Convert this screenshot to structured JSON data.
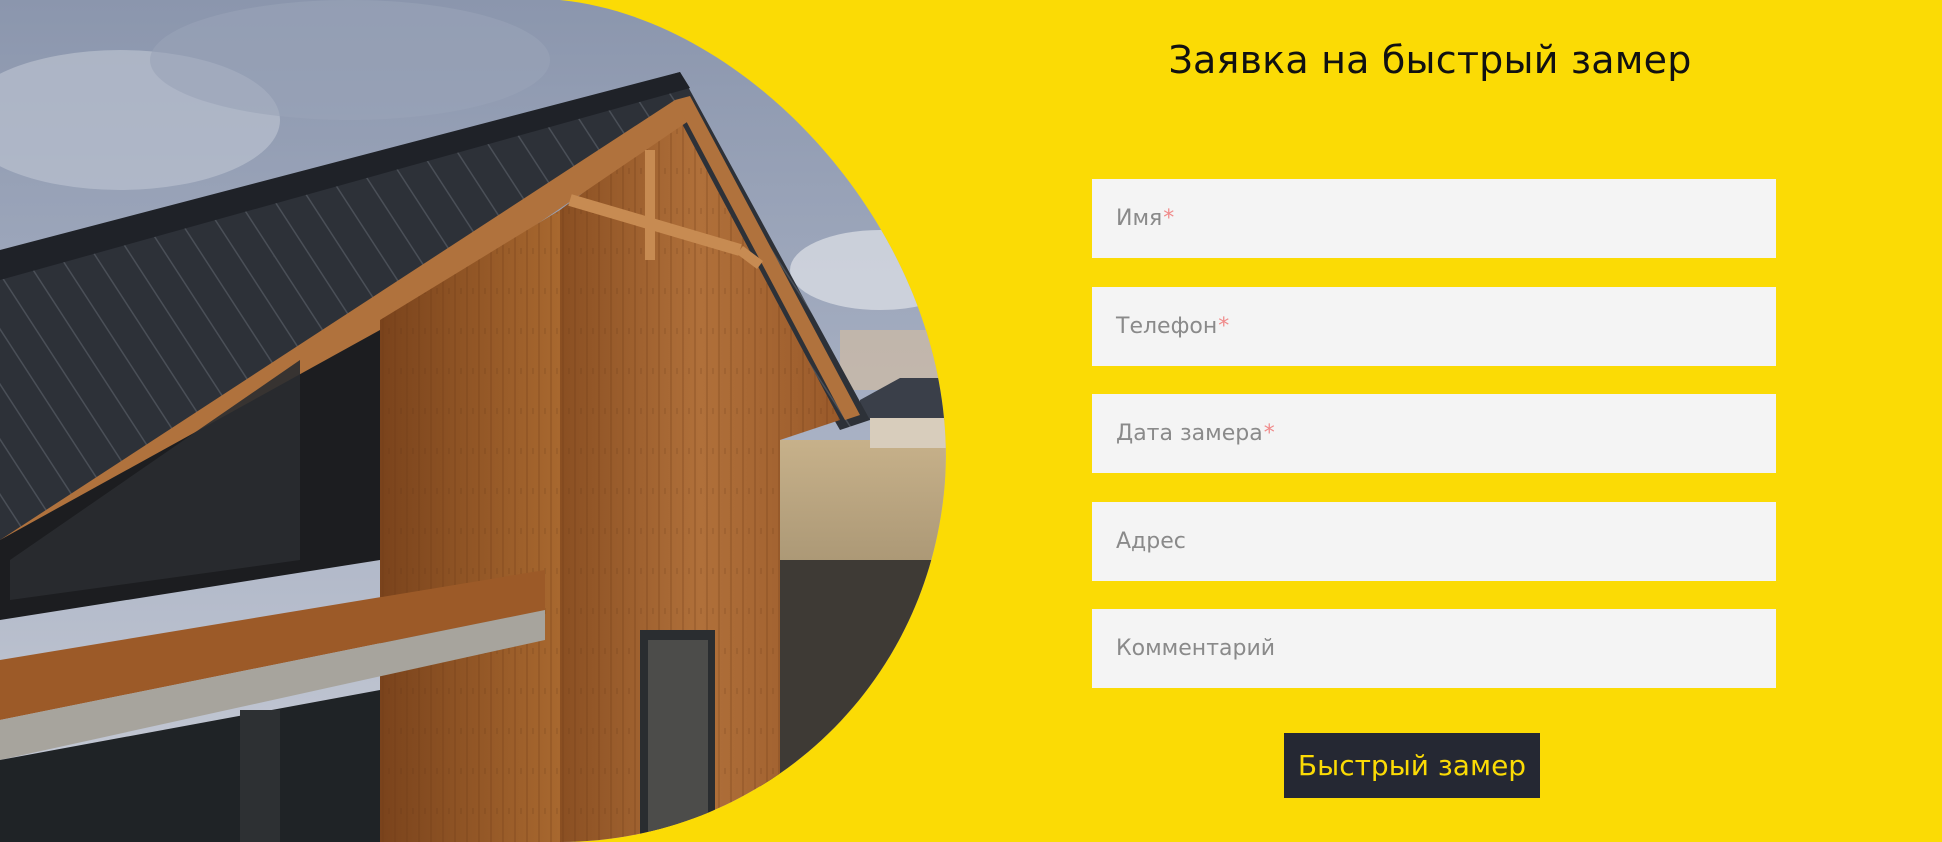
{
  "form": {
    "title": "Заявка на быстрый замер",
    "fields": [
      {
        "placeholder": "Имя",
        "required_mark": "*"
      },
      {
        "placeholder": "Телефон",
        "required_mark": "*"
      },
      {
        "placeholder": "Дата замера",
        "required_mark": "*"
      },
      {
        "placeholder": "Адрес",
        "required_mark": ""
      },
      {
        "placeholder": "Комментарий",
        "required_mark": ""
      }
    ],
    "submit_label": "Быстрый замер"
  },
  "colors": {
    "background": "#fbdb05",
    "field_bg": "#f4f4f4",
    "button_bg": "#252833",
    "button_text": "#fbdb05",
    "required_mark": "#f08a8a"
  },
  "image": {
    "subject": "wooden-house-photo"
  }
}
